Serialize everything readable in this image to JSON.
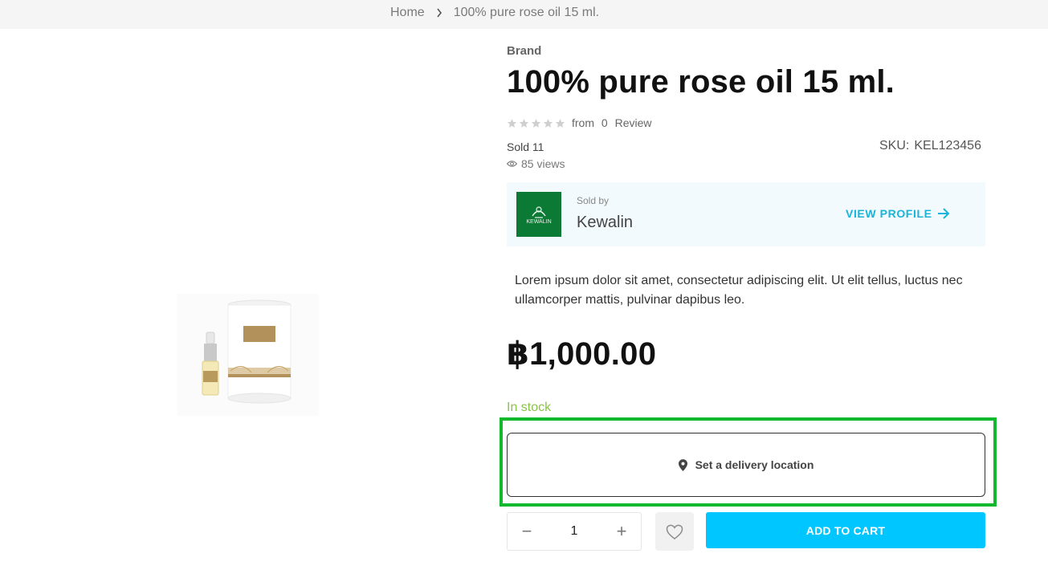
{
  "breadcrumb": {
    "home": "Home",
    "separator_icon": "chevron-right-icon",
    "current": "100% pure rose oil 15 ml."
  },
  "product": {
    "brand": "Brand",
    "title": "100% pure rose oil 15 ml.",
    "rating": {
      "stars": 0,
      "max_stars": 5,
      "from_label": "from",
      "review_count": "0",
      "review_label": "Review"
    },
    "sold": "Sold 11",
    "views": "85 views",
    "sku_label": "SKU:",
    "sku_value": "KEL123456",
    "description": "Lorem ipsum dolor sit amet, consectetur adipiscing elit. Ut elit tellus, luctus nec ullamcorper mattis, pulvinar dapibus leo.",
    "price": "฿1,000.00",
    "stock_status": "In stock",
    "image_alt": "100% PURE BULGARIAN ROSE OIL"
  },
  "seller": {
    "sold_by_label": "Sold by",
    "name": "Kewalin",
    "logo_text": "KEWALIN",
    "view_profile_label": "VIEW PROFILE"
  },
  "delivery": {
    "label": "Set a delivery location"
  },
  "cart": {
    "quantity": "1",
    "minus_label": "−",
    "plus_label": "+",
    "add_to_cart_label": "ADD TO CART"
  },
  "colors": {
    "accent": "#00c6ff",
    "link": "#19b4d9",
    "stock": "#8bc34a",
    "highlight": "#12b82e",
    "seller_logo_bg": "#0a7a35"
  }
}
